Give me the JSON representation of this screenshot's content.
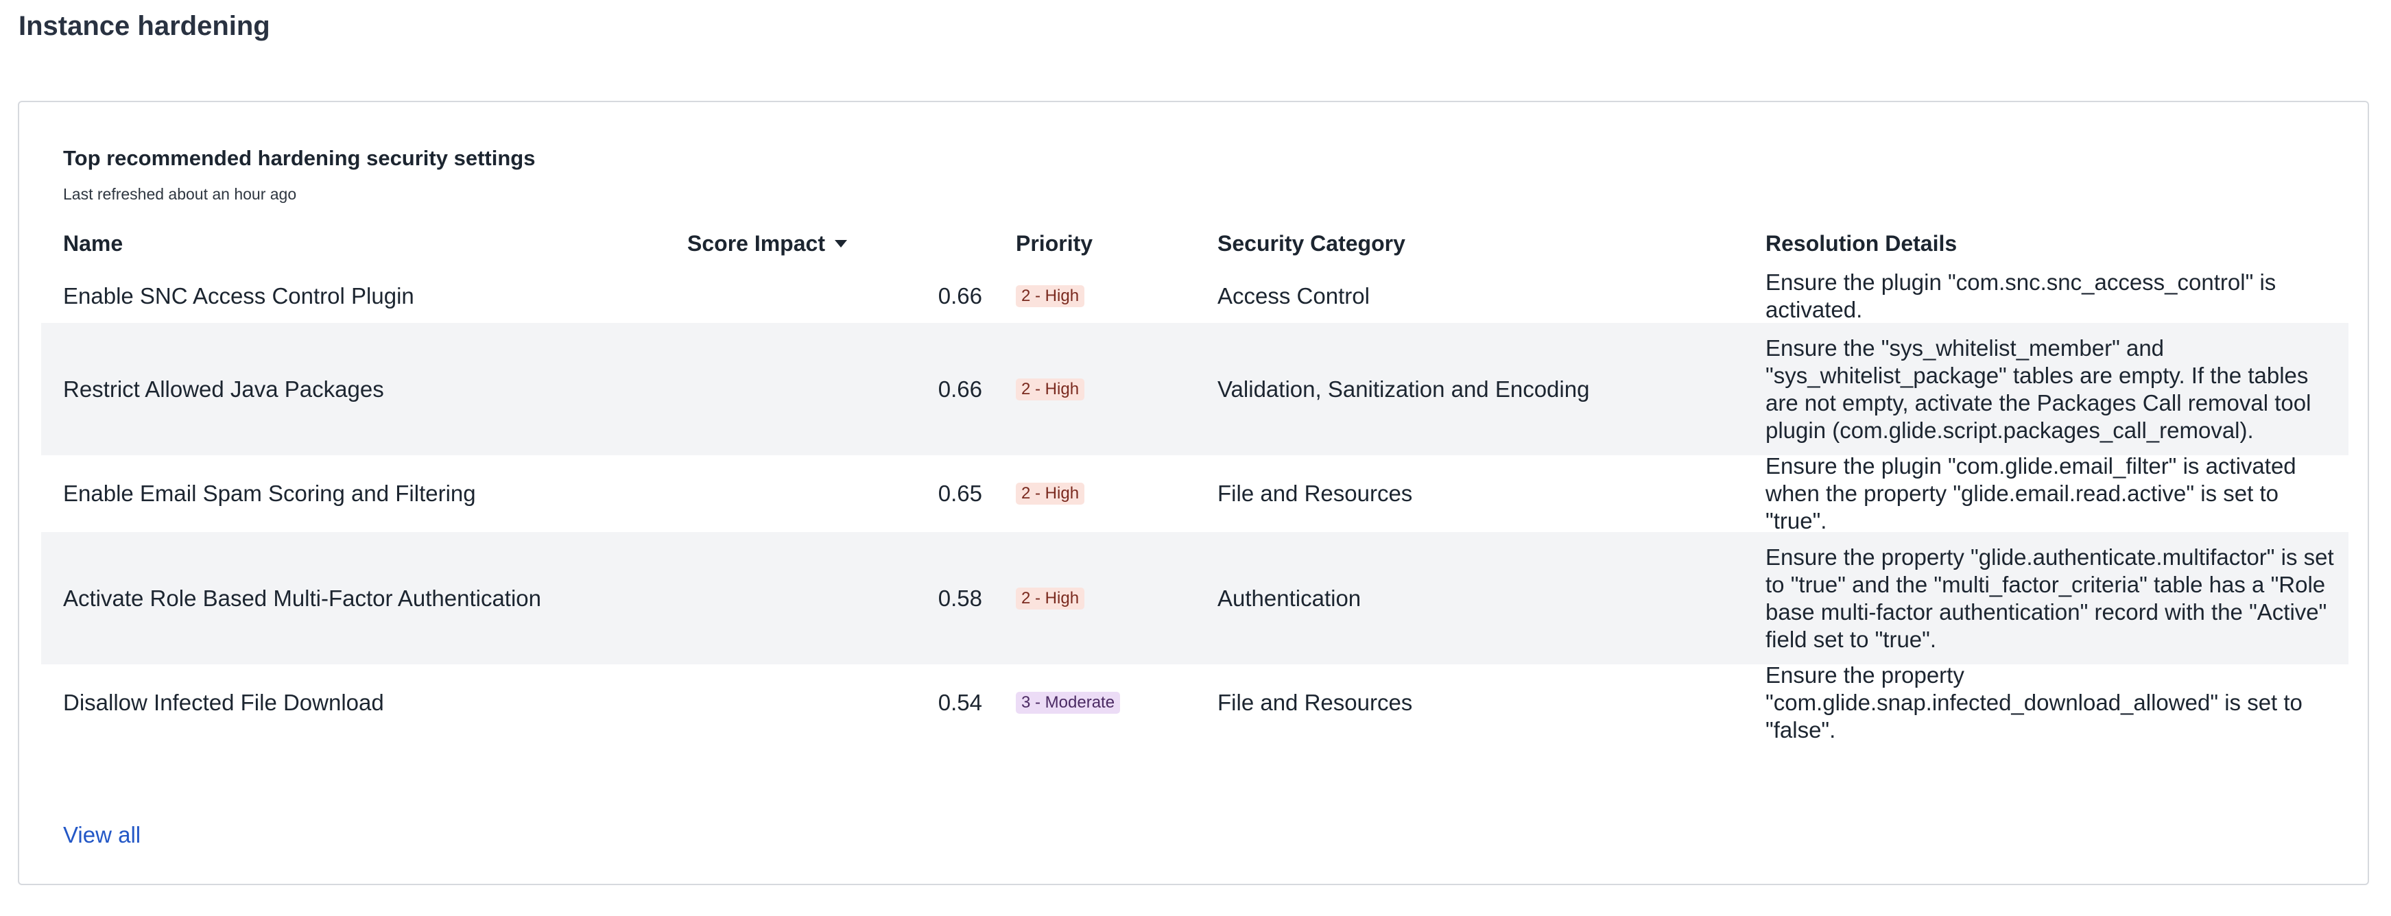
{
  "page": {
    "title": "Instance hardening"
  },
  "card": {
    "title": "Top recommended hardening security settings",
    "subtitle": "Last refreshed about an hour ago",
    "view_all": "View all"
  },
  "table": {
    "columns": {
      "name": "Name",
      "score_impact": "Score Impact",
      "priority": "Priority",
      "category": "Security Category",
      "resolution": "Resolution Details"
    },
    "sort": {
      "column": "score_impact",
      "direction": "descending",
      "icon": "caret-down-icon"
    },
    "rows": [
      {
        "name": "Enable SNC Access Control Plugin",
        "score": "0.66",
        "priority": "2 - High",
        "category": "Access Control",
        "resolution": "Ensure the plugin \"com.snc.snc_access_control\" is activated."
      },
      {
        "name": "Restrict Allowed Java Packages",
        "score": "0.66",
        "priority": "2 - High",
        "category": "Validation, Sanitization and Encoding",
        "resolution": "Ensure the \"sys_whitelist_member\" and \"sys_whitelist_package\" tables are empty. If the tables are not empty, activate the Packages Call removal tool plugin (com.glide.script.packages_call_removal)."
      },
      {
        "name": "Enable Email Spam Scoring and Filtering",
        "score": "0.65",
        "priority": "2 - High",
        "category": "File and Resources",
        "resolution": "Ensure the plugin \"com.glide.email_filter\" is activated when the property \"glide.email.read.active\" is set to \"true\"."
      },
      {
        "name": "Activate Role Based Multi-Factor Authentication",
        "score": "0.58",
        "priority": "2 - High",
        "category": "Authentication",
        "resolution": "Ensure the property \"glide.authenticate.multifactor\" is set to \"true\" and the \"multi_factor_criteria\" table has a \"Role base multi-factor authentication\" record with the \"Active\" field set to \"true\"."
      },
      {
        "name": "Disallow Infected File Download",
        "score": "0.54",
        "priority": "3 - Moderate",
        "category": "File and Resources",
        "resolution": "Ensure the property \"com.glide.snap.infected_download_allowed\" is set to \"false\"."
      }
    ]
  },
  "colors": {
    "high_badge_bg": "#fbe3dd",
    "moderate_badge_bg": "#ecdcf6",
    "link": "#2357c6",
    "row_shade": "#f3f4f6"
  }
}
